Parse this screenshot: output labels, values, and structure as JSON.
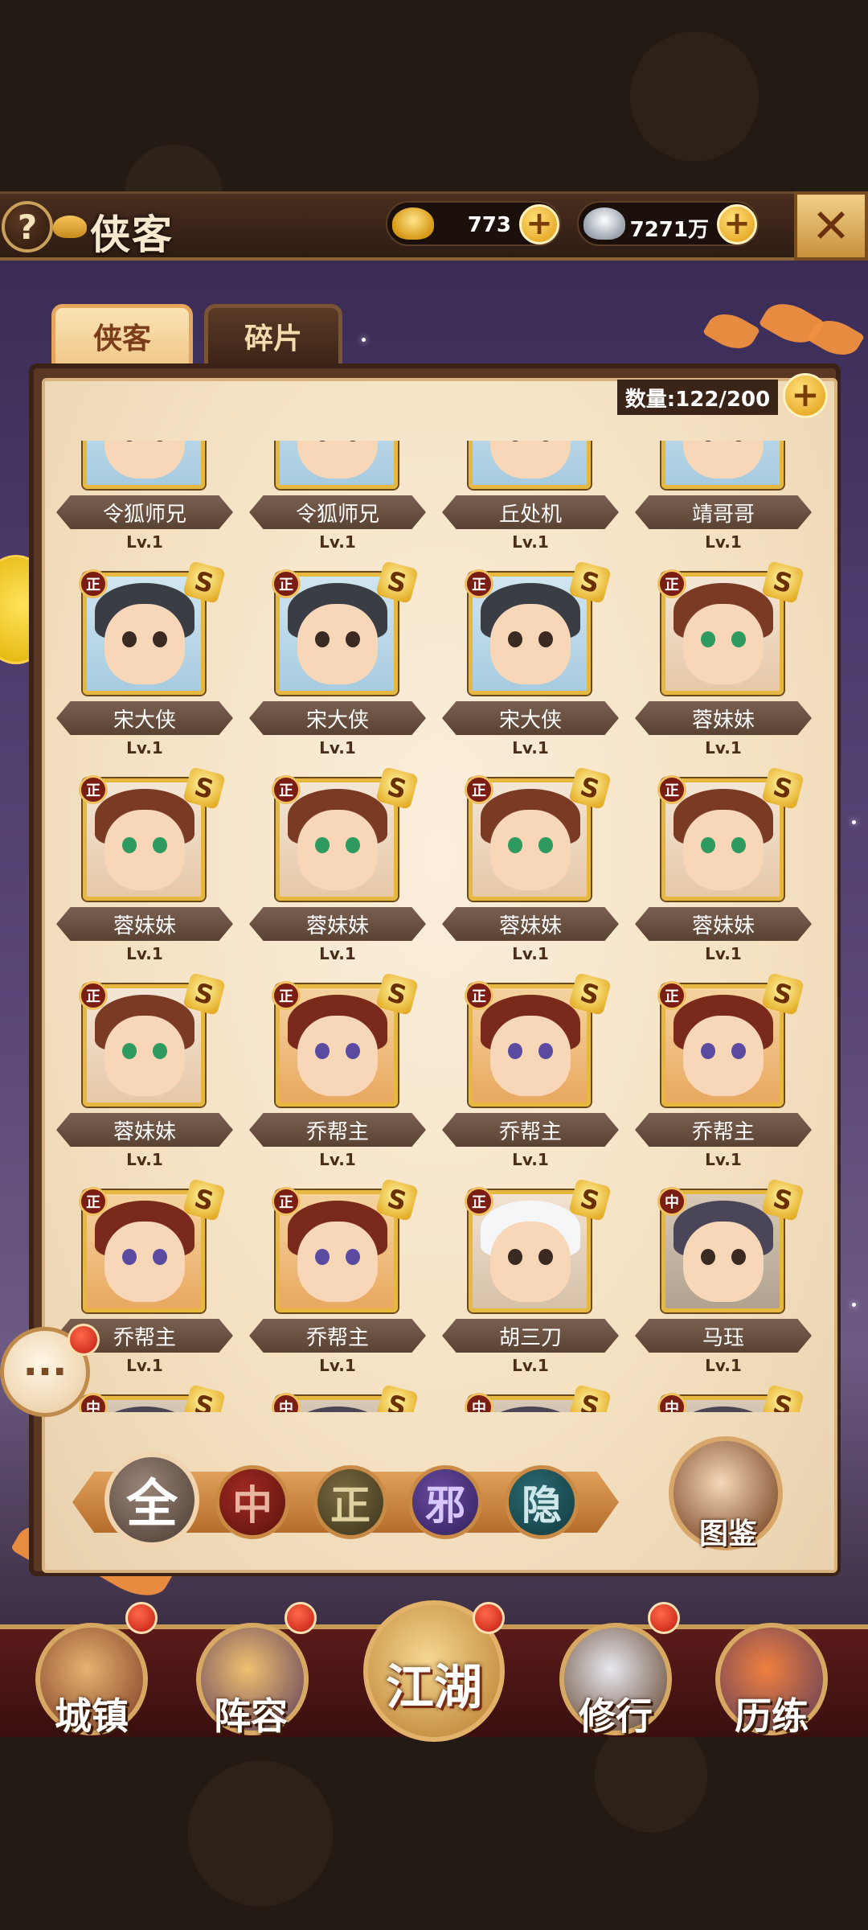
{
  "header": {
    "help_icon": "?",
    "title": "侠客",
    "gold": {
      "icon": "gold-ingot-icon",
      "value": "773",
      "plus": "+"
    },
    "silver": {
      "icon": "silver-ingot-icon",
      "value": "7271万",
      "plus": "+"
    },
    "close_icon": "✕"
  },
  "tabs": [
    {
      "label": "侠客",
      "active": true
    },
    {
      "label": "碎片",
      "active": false
    }
  ],
  "count": {
    "text": "数量:122/200",
    "plus": "+"
  },
  "heroes": [
    {
      "name": "令狐师兄",
      "level": "Lv.1",
      "faction": "",
      "grade": "",
      "type": "zheng"
    },
    {
      "name": "令狐师兄",
      "level": "Lv.1",
      "faction": "",
      "grade": "",
      "type": "zheng"
    },
    {
      "name": "丘处机",
      "level": "Lv.1",
      "faction": "",
      "grade": "",
      "type": "zheng"
    },
    {
      "name": "靖哥哥",
      "level": "Lv.1",
      "faction": "",
      "grade": "",
      "type": "zheng"
    },
    {
      "name": "宋大侠",
      "level": "Lv.1",
      "faction": "正",
      "grade": "S",
      "type": "zheng"
    },
    {
      "name": "宋大侠",
      "level": "Lv.1",
      "faction": "正",
      "grade": "S",
      "type": "zheng"
    },
    {
      "name": "宋大侠",
      "level": "Lv.1",
      "faction": "正",
      "grade": "S",
      "type": "zheng"
    },
    {
      "name": "蓉妹妹",
      "level": "Lv.1",
      "faction": "正",
      "grade": "S",
      "type": "rong"
    },
    {
      "name": "蓉妹妹",
      "level": "Lv.1",
      "faction": "正",
      "grade": "S",
      "type": "rong"
    },
    {
      "name": "蓉妹妹",
      "level": "Lv.1",
      "faction": "正",
      "grade": "S",
      "type": "rong"
    },
    {
      "name": "蓉妹妹",
      "level": "Lv.1",
      "faction": "正",
      "grade": "S",
      "type": "rong"
    },
    {
      "name": "蓉妹妹",
      "level": "Lv.1",
      "faction": "正",
      "grade": "S",
      "type": "rong"
    },
    {
      "name": "蓉妹妹",
      "level": "Lv.1",
      "faction": "正",
      "grade": "S",
      "type": "rong"
    },
    {
      "name": "乔帮主",
      "level": "Lv.1",
      "faction": "正",
      "grade": "S",
      "type": "qiao"
    },
    {
      "name": "乔帮主",
      "level": "Lv.1",
      "faction": "正",
      "grade": "S",
      "type": "qiao"
    },
    {
      "name": "乔帮主",
      "level": "Lv.1",
      "faction": "正",
      "grade": "S",
      "type": "qiao"
    },
    {
      "name": "乔帮主",
      "level": "Lv.1",
      "faction": "正",
      "grade": "S",
      "type": "qiao"
    },
    {
      "name": "乔帮主",
      "level": "Lv.1",
      "faction": "正",
      "grade": "S",
      "type": "qiao"
    },
    {
      "name": "胡三刀",
      "level": "Lv.1",
      "faction": "正",
      "grade": "S",
      "type": "hu"
    },
    {
      "name": "马珏",
      "level": "Lv.1",
      "faction": "中",
      "grade": "S",
      "type": "ma"
    },
    {
      "name": "",
      "level": "",
      "faction": "中",
      "grade": "S",
      "type": "ma"
    },
    {
      "name": "",
      "level": "",
      "faction": "中",
      "grade": "S",
      "type": "ma"
    },
    {
      "name": "",
      "level": "",
      "faction": "中",
      "grade": "S",
      "type": "ma"
    },
    {
      "name": "",
      "level": "",
      "faction": "中",
      "grade": "S",
      "type": "ma"
    }
  ],
  "filters": {
    "all": "全",
    "zhong": "中",
    "zheng": "正",
    "xie": "邪",
    "yin": "隐",
    "codex": "图鉴"
  },
  "chat_icon": "···",
  "nav": {
    "town": "城镇",
    "lineup": "阵容",
    "jianghu": "江湖",
    "train": "修行",
    "trial": "历练"
  }
}
